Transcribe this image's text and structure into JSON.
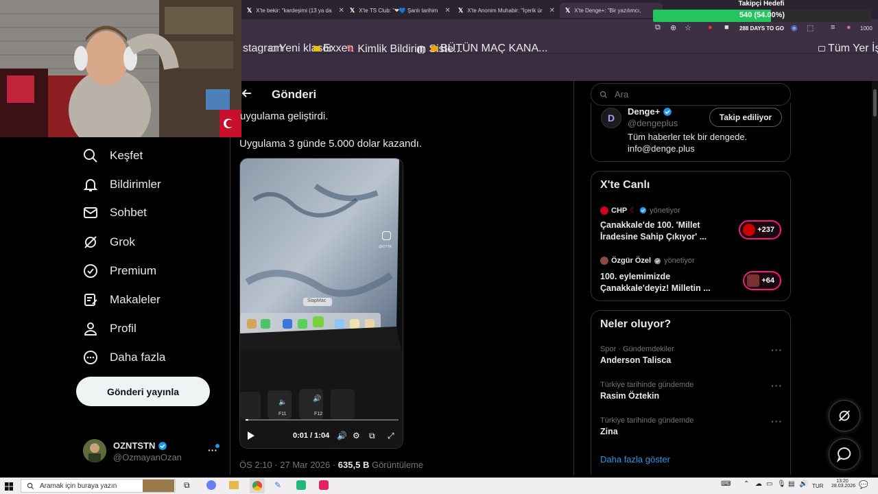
{
  "browser": {
    "tabs": [
      {
        "label": "X'te bekir: \"kardeşimi (13 ya da"
      },
      {
        "label": "X'te TS Club: \"❤💙 Şanlı tarihim"
      },
      {
        "label": "X'te Anonim Muhabir: \"İçerik ür"
      },
      {
        "label": "X'te Denge+: \"Bir yazılımcı,"
      }
    ],
    "bookmarks": [
      {
        "label": "stagram"
      },
      {
        "label": "Yeni klasör"
      },
      {
        "label": "Exxen"
      },
      {
        "label": "Kimlik Bildirim Siste..."
      },
      {
        "label": "BÜTÜN MAÇ KANA..."
      }
    ],
    "bookmarks_right": "Tüm Yer İşaretleri",
    "toolbar_text": "288 DAYS TO GO",
    "toolbar_count": "1000"
  },
  "overlay": {
    "goal_title": "Takipçi Hedefi",
    "goal_text": "540 (54.00%)",
    "goal_fraction": 0.54,
    "goal_color": "#22c55e"
  },
  "nav": {
    "items": [
      {
        "label": "Keşfet",
        "icon": "search-icon"
      },
      {
        "label": "Bildirimler",
        "icon": "bell-icon"
      },
      {
        "label": "Sohbet",
        "icon": "mail-icon"
      },
      {
        "label": "Grok",
        "icon": "grok-icon"
      },
      {
        "label": "Premium",
        "icon": "verified-icon"
      },
      {
        "label": "Makaleler",
        "icon": "article-icon"
      },
      {
        "label": "Profil",
        "icon": "person-icon"
      },
      {
        "label": "Daha fazla",
        "icon": "more-circle-icon"
      }
    ],
    "post_button": "Gönderi yayınla",
    "profile": {
      "name": "OZNTSTN",
      "handle": "@OzmayanOzan"
    }
  },
  "main": {
    "header_title": "Gönderi",
    "tweet_line1": "uygulama geliştirdi.",
    "tweet_line2": "Uygulama 3 günde 5.000 dolar kazandı.",
    "video": {
      "tooltip": "SlapMac",
      "watermark": "@KITTA",
      "time": "0:01 / 1:04",
      "key_f11": "F11",
      "key_f12": "F12"
    },
    "meta_time": "ÖS 2:10 · 27 Mar 2026 · ",
    "meta_views": "635,5 B",
    "meta_views_label": " Görüntüleme"
  },
  "right": {
    "search_placeholder": "Ara",
    "denge": {
      "name": "Denge+",
      "handle": "@dengeplus",
      "follow_label": "Takip ediliyor",
      "bio1": "Tüm haberler tek bir dengede.",
      "bio2": "info@denge.plus",
      "avatar_letter": "D"
    },
    "live": {
      "title": "X'te Canlı",
      "items": [
        {
          "host": "CHP",
          "role": "yönetiyor",
          "text1": "Çanakkale'de 100. 'Millet",
          "text2": "İradesine Sahip Çıkıyor' ...",
          "count": "+237"
        },
        {
          "host": "Özgür Özel",
          "role": "yönetiyor",
          "text1": "100. eylemimizde",
          "text2": "Çanakkale'deyiz! Milletin ...",
          "count": "+64"
        }
      ]
    },
    "trends": {
      "title": "Neler oluyor?",
      "items": [
        {
          "category": "Spor · Gündemdekiler",
          "name": "Anderson Talisca"
        },
        {
          "category": "Türkiye tarihinde gündemde",
          "name": "Rasim Öztekin"
        },
        {
          "category": "Türkiye tarihinde gündemde",
          "name": "Zina"
        }
      ],
      "show_more": "Daha fazla göster"
    }
  },
  "taskbar": {
    "search_placeholder": "Aramak için buraya yazın",
    "lang": "TUR",
    "time": "13:20",
    "date": "28.03.2026"
  }
}
